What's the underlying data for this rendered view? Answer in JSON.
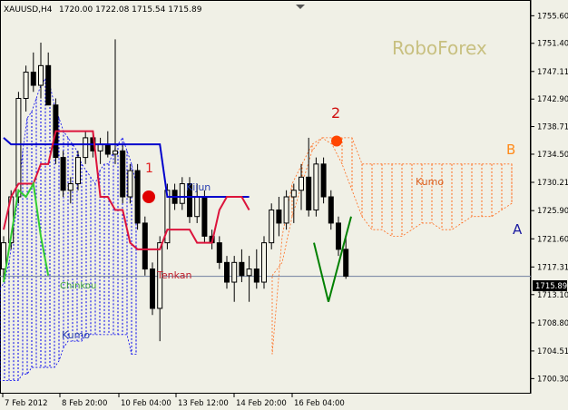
{
  "header": {
    "symbol": "XAUUSD,H4",
    "ohlc": "1720.00 1722.08 1715.54 1715.89"
  },
  "watermark": "RoboForex",
  "current_price_label": "1715.89",
  "chart_data": {
    "type": "candlestick",
    "y_axis": {
      "range": [
        1698.0,
        1758.0
      ],
      "tick_labels": [
        "1755.60",
        "1751.40",
        "1747.11",
        "1742.90",
        "1738.71",
        "1734.50",
        "1730.21",
        "1725.90",
        "1721.60",
        "1717.31",
        "1713.10",
        "1708.80",
        "1704.51",
        "1700.30"
      ]
    },
    "x_axis": {
      "tick_labels": [
        "7 Feb 2012",
        "8 Feb 20:00",
        "10 Feb 04:00",
        "13 Feb 12:00",
        "14 Feb 20:00",
        "16 Feb 04:00"
      ]
    },
    "candles": [
      [
        1717.0,
        1722.0,
        1715.0,
        1721.0
      ],
      [
        1721.0,
        1729.0,
        1720.0,
        1728.0
      ],
      [
        1728.0,
        1744.0,
        1727.0,
        1743.0
      ],
      [
        1743.0,
        1748.0,
        1741.0,
        1747.0
      ],
      [
        1747.0,
        1750.0,
        1744.0,
        1745.0
      ],
      [
        1745.0,
        1751.5,
        1743.0,
        1748.0
      ],
      [
        1748.0,
        1750.0,
        1742.0,
        1742.0
      ],
      [
        1742.0,
        1743.0,
        1733.0,
        1734.0
      ],
      [
        1734.0,
        1735.0,
        1728.0,
        1729.0
      ],
      [
        1729.0,
        1731.0,
        1727.0,
        1730.0
      ],
      [
        1730.0,
        1735.0,
        1729.0,
        1734.0
      ],
      [
        1734.0,
        1738.0,
        1733.0,
        1737.0
      ],
      [
        1737.0,
        1738.0,
        1734.0,
        1735.0
      ],
      [
        1735.0,
        1737.0,
        1733.0,
        1736.0
      ],
      [
        1736.0,
        1738.0,
        1734.0,
        1734.5
      ],
      [
        1734.5,
        1752.0,
        1733.0,
        1735.0
      ],
      [
        1735.0,
        1736.0,
        1727.0,
        1728.0
      ],
      [
        1728.0,
        1733.0,
        1727.0,
        1732.0
      ],
      [
        1732.0,
        1733.0,
        1723.0,
        1724.0
      ],
      [
        1724.0,
        1725.0,
        1716.0,
        1717.0
      ],
      [
        1717.0,
        1718.0,
        1710.0,
        1711.0
      ],
      [
        1711.0,
        1722.0,
        1706.0,
        1721.0
      ],
      [
        1721.0,
        1730.0,
        1720.0,
        1729.0
      ],
      [
        1729.0,
        1730.0,
        1726.0,
        1727.0
      ],
      [
        1727.0,
        1731.0,
        1726.0,
        1730.0
      ],
      [
        1730.0,
        1731.0,
        1724.0,
        1725.0
      ],
      [
        1725.0,
        1730.0,
        1724.0,
        1728.0
      ],
      [
        1728.0,
        1729.0,
        1721.0,
        1722.0
      ],
      [
        1722.0,
        1723.0,
        1720.0,
        1721.0
      ],
      [
        1721.0,
        1722.0,
        1717.0,
        1718.0
      ],
      [
        1718.0,
        1719.0,
        1714.0,
        1715.0
      ],
      [
        1715.0,
        1719.0,
        1712.0,
        1718.0
      ],
      [
        1718.0,
        1720.0,
        1715.0,
        1716.0
      ],
      [
        1716.0,
        1719.0,
        1712.0,
        1717.0
      ],
      [
        1717.0,
        1720.0,
        1714.0,
        1715.0
      ],
      [
        1715.0,
        1722.0,
        1714.0,
        1721.0
      ],
      [
        1721.0,
        1727.0,
        1720.0,
        1726.0
      ],
      [
        1726.0,
        1728.0,
        1722.0,
        1724.0
      ],
      [
        1724.0,
        1729.0,
        1723.0,
        1728.0
      ],
      [
        1728.0,
        1730.0,
        1724.0,
        1729.0
      ],
      [
        1729.0,
        1733.0,
        1726.0,
        1731.0
      ],
      [
        1731.0,
        1737.0,
        1725.0,
        1726.0
      ],
      [
        1726.0,
        1734.0,
        1725.0,
        1733.0
      ],
      [
        1733.0,
        1734.0,
        1727.0,
        1728.0
      ],
      [
        1728.0,
        1729.0,
        1723.0,
        1724.0
      ],
      [
        1724.0,
        1725.0,
        1719.0,
        1720.0
      ],
      [
        1720.0,
        1722.0,
        1715.5,
        1715.9
      ]
    ],
    "tenkan": [
      1723.0,
      1728.0,
      1730.0,
      1730.0,
      1730.0,
      1733.0,
      1733.0,
      1738.0,
      1738.0,
      1738.0,
      1738.0,
      1738.0,
      1738.0,
      1728.0,
      1728.0,
      1726.0,
      1726.0,
      1721.0,
      1720.0,
      1720.0,
      1720.0,
      1720.0,
      1723.0,
      1723.0,
      1723.0,
      1723.0,
      1721.0,
      1721.0,
      1721.0,
      1726.0,
      1728.0,
      1728.0,
      1728.0,
      1726.0
    ],
    "kijun": [
      1737.0,
      1736.0,
      1736.0,
      1736.0,
      1736.0,
      1736.0,
      1736.0,
      1736.0,
      1736.0,
      1736.0,
      1736.0,
      1736.0,
      1736.0,
      1736.0,
      1736.0,
      1736.0,
      1736.0,
      1736.0,
      1736.0,
      1736.0,
      1736.0,
      1736.0,
      1728.0,
      1728.0,
      1728.0,
      1728.0,
      1728.0,
      1728.0,
      1728.0,
      1728.0,
      1728.0,
      1728.0,
      1728.0,
      1728.0
    ],
    "chinkou": [
      1715.0,
      1722.0,
      1729.0,
      1728.0,
      1730.0,
      1722.0,
      1716.0
    ],
    "kumo_bull": {
      "span_a": [
        1714.0,
        1715.0,
        1718.0,
        1723.0,
        1728.0,
        1735.0,
        1740.0,
        1741.0,
        1743.0,
        1745.0,
        1746.0,
        1745.0,
        1742.0,
        1740.0,
        1738.0,
        1737.0,
        1736.0,
        1735.0,
        1733.0,
        1732.0,
        1731.0,
        1730.0,
        1732.0,
        1733.0,
        1733.0,
        1735.0,
        1736.0,
        1737.0,
        1735.0,
        1733.0,
        1730.0
      ],
      "span_b": [
        1700.0,
        1700.0,
        1700.0,
        1700.0,
        1700.0,
        1701.0,
        1701.0,
        1702.0,
        1702.0,
        1702.0,
        1702.0,
        1702.0,
        1702.0,
        1703.0,
        1705.0,
        1706.0,
        1706.0,
        1706.0,
        1706.0,
        1707.0,
        1707.0,
        1707.0,
        1707.0,
        1707.0,
        1707.0,
        1707.0,
        1707.0,
        1707.0,
        1707.0,
        1704.0,
        1704.0
      ]
    },
    "kumo_bear": {
      "span_a": [
        1716.0,
        1718.0,
        1725.0,
        1730.0,
        1735.0,
        1737.0,
        1737.0,
        1737.0,
        1737.0,
        1733.0,
        1733.0,
        1733.0,
        1733.0,
        1733.0,
        1733.0,
        1733.0,
        1733.0,
        1733.0,
        1733.0,
        1733.0,
        1733.0,
        1733.0,
        1733.0,
        1733.0,
        1733.0
      ],
      "span_b": [
        1704.0,
        1722.0,
        1730.0,
        1733.0,
        1736.0,
        1737.0,
        1736.0,
        1733.0,
        1729.0,
        1725.0,
        1723.0,
        1723.0,
        1722.0,
        1722.0,
        1723.0,
        1724.0,
        1724.0,
        1723.0,
        1723.0,
        1724.0,
        1725.0,
        1725.0,
        1725.0,
        1726.0,
        1727.0
      ]
    },
    "forecast": [
      [
        1721.0,
        1712.0
      ],
      [
        1712.0,
        1725.0
      ]
    ],
    "marker_1": 1728.0,
    "marker_2": 1736.5,
    "current_price": 1715.89,
    "annotations": {
      "kijun": "Kijun",
      "tenkan": "Tenkan",
      "chinkou": "Chinkou",
      "kumo_left": "Kumo",
      "kumo_right": "Kumo",
      "one": "1",
      "two": "2",
      "a": "A",
      "b": "B"
    },
    "colors": {
      "background": "#f0f0e6",
      "bull_candle": "#f5f5ea",
      "bear_candle": "#000000",
      "kumo_bull": "#0000ee",
      "kumo_bear": "#ff6a1a",
      "tenkan": "#dc143c",
      "kijun": "#0000cc",
      "chinkou": "#32cd32",
      "forecast": "#008000",
      "marker_1": "#e00000",
      "marker_2": "#ff4500",
      "watermark": "#c8c080",
      "price_line": "#7080a0"
    }
  }
}
